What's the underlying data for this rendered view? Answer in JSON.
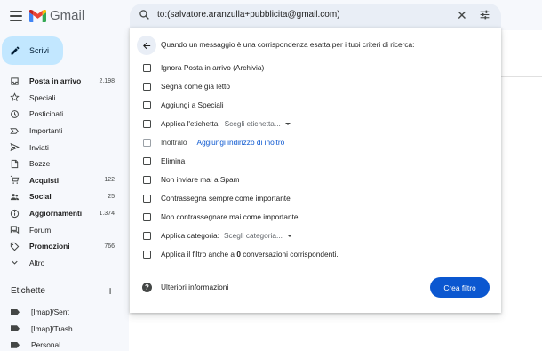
{
  "app": {
    "name": "Gmail"
  },
  "search": {
    "value": "to:(salvatore.aranzulla+pubblicita@gmail.com)"
  },
  "compose": {
    "label": "Scrivi"
  },
  "nav": [
    {
      "label": "Posta in arrivo",
      "count": "2.198",
      "bold": true,
      "icon": "inbox-icon"
    },
    {
      "label": "Speciali",
      "count": "",
      "bold": false,
      "icon": "star-icon"
    },
    {
      "label": "Posticipati",
      "count": "",
      "bold": false,
      "icon": "clock-icon"
    },
    {
      "label": "Importanti",
      "count": "",
      "bold": false,
      "icon": "important-icon"
    },
    {
      "label": "Inviati",
      "count": "",
      "bold": false,
      "icon": "send-icon"
    },
    {
      "label": "Bozze",
      "count": "",
      "bold": false,
      "icon": "draft-icon"
    },
    {
      "label": "Acquisti",
      "count": "122",
      "bold": true,
      "icon": "cart-icon"
    },
    {
      "label": "Social",
      "count": "25",
      "bold": true,
      "icon": "people-icon"
    },
    {
      "label": "Aggiornamenti",
      "count": "1.374",
      "bold": true,
      "icon": "info-icon"
    },
    {
      "label": "Forum",
      "count": "",
      "bold": false,
      "icon": "forum-icon"
    },
    {
      "label": "Promozioni",
      "count": "766",
      "bold": true,
      "icon": "tag-icon"
    },
    {
      "label": "Altro",
      "count": "",
      "bold": false,
      "icon": "chevron-down-icon"
    }
  ],
  "labels": {
    "title": "Etichette",
    "items": [
      "[Imap]/Sent",
      "[Imap]/Trash",
      "Personal"
    ]
  },
  "filter": {
    "criteria": "Quando un messaggio è una corrispondenza esatta per i tuoi criteri di ricerca:",
    "options": {
      "skip_inbox": "Ignora Posta in arrivo (Archivia)",
      "mark_read": "Segna come già letto",
      "star": "Aggiungi a Speciali",
      "apply_label": "Applica l'etichetta:",
      "apply_label_select": "Scegli etichetta...",
      "forward": "Inoltralo",
      "forward_link": "Aggiungi indirizzo di inoltro",
      "delete": "Elimina",
      "never_spam": "Non inviare mai a Spam",
      "always_important": "Contrassegna sempre come importante",
      "never_important": "Non contrassegnare mai come importante",
      "category": "Applica categoria:",
      "category_select": "Scegli categoria...",
      "also_apply_pre": "Applica il filtro anche a ",
      "also_apply_count": "0",
      "also_apply_post": " conversazioni corrispondenti."
    },
    "help": "Ulteriori informazioni",
    "create_button": "Crea filtro"
  }
}
